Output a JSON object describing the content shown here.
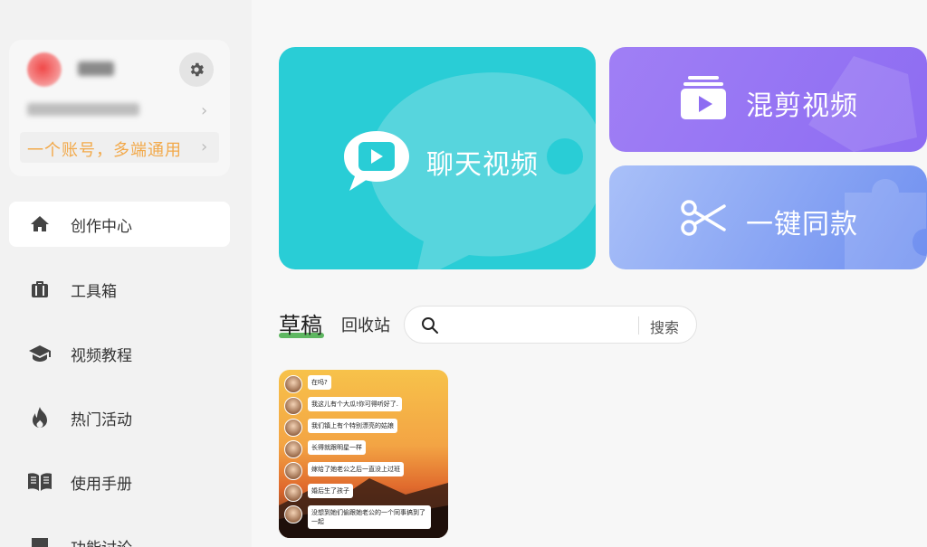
{
  "account": {
    "promo_text": "一个账号，多端通用"
  },
  "sidebar": {
    "items": [
      {
        "label": "创作中心",
        "icon": "home-icon"
      },
      {
        "label": "工具箱",
        "icon": "toolbox-icon"
      },
      {
        "label": "视频教程",
        "icon": "graduation-cap-icon"
      },
      {
        "label": "热门活动",
        "icon": "flame-icon"
      },
      {
        "label": "使用手册",
        "icon": "book-icon"
      },
      {
        "label": "功能讨论",
        "icon": "chat-icon"
      }
    ]
  },
  "cards": {
    "chat_video": "聊天视频",
    "mix_video": "混剪视频",
    "one_click": "一键同款"
  },
  "tabs": {
    "draft": "草稿",
    "recycle": "回收站"
  },
  "search": {
    "placeholder": "",
    "button": "搜索"
  },
  "draft": {
    "messages": [
      "在吗?",
      "我这儿有个大瓜!你可得听好了.",
      "我们镇上有个特别漂亮的姑娘",
      "长得就跟明星一样",
      "嫁给了她老公之后一直没上过班",
      "婚后生了孩子",
      "没想到她们偷跟她老公的一个同事搞到了一起"
    ]
  },
  "colors": {
    "chat_card": "#29cdd6",
    "mix_card": "#8d6cf2",
    "clone_card": "#6f8ff0",
    "promo": "#f2a94a",
    "tab_underline": "#4caf50"
  }
}
